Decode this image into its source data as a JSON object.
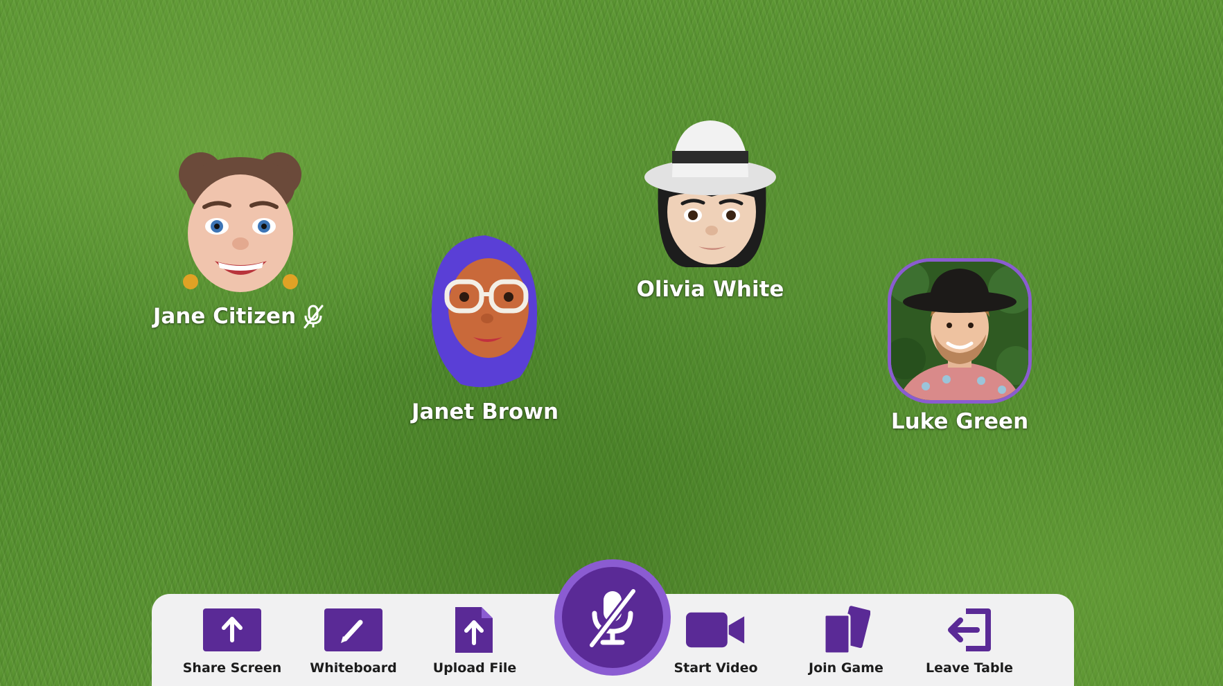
{
  "participants": [
    {
      "name": "Jane Citizen",
      "muted": true,
      "avatar_type": "memoji"
    },
    {
      "name": "Janet Brown",
      "muted": false,
      "avatar_type": "memoji"
    },
    {
      "name": "Olivia White",
      "muted": false,
      "avatar_type": "memoji"
    },
    {
      "name": "Luke Green",
      "muted": false,
      "avatar_type": "photo"
    }
  ],
  "toolbar": {
    "share_screen_label": "Share Screen",
    "whiteboard_label": "Whiteboard",
    "upload_file_label": "Upload File",
    "start_video_label": "Start Video",
    "join_game_label": "Join Game",
    "leave_table_label": "Leave Table",
    "mic_state": "muted"
  },
  "colors": {
    "accent": "#5a2a96",
    "accent_light": "#8b5cd2",
    "toolbar_bg": "#f1f1f2",
    "background": "grass-green"
  },
  "icons": {
    "share_screen": "upload-arrow-icon",
    "whiteboard": "pencil-icon",
    "upload_file": "file-upload-icon",
    "microphone": "microphone-muted-icon",
    "start_video": "video-camera-icon",
    "join_game": "playing-cards-icon",
    "leave_table": "exit-door-icon"
  }
}
